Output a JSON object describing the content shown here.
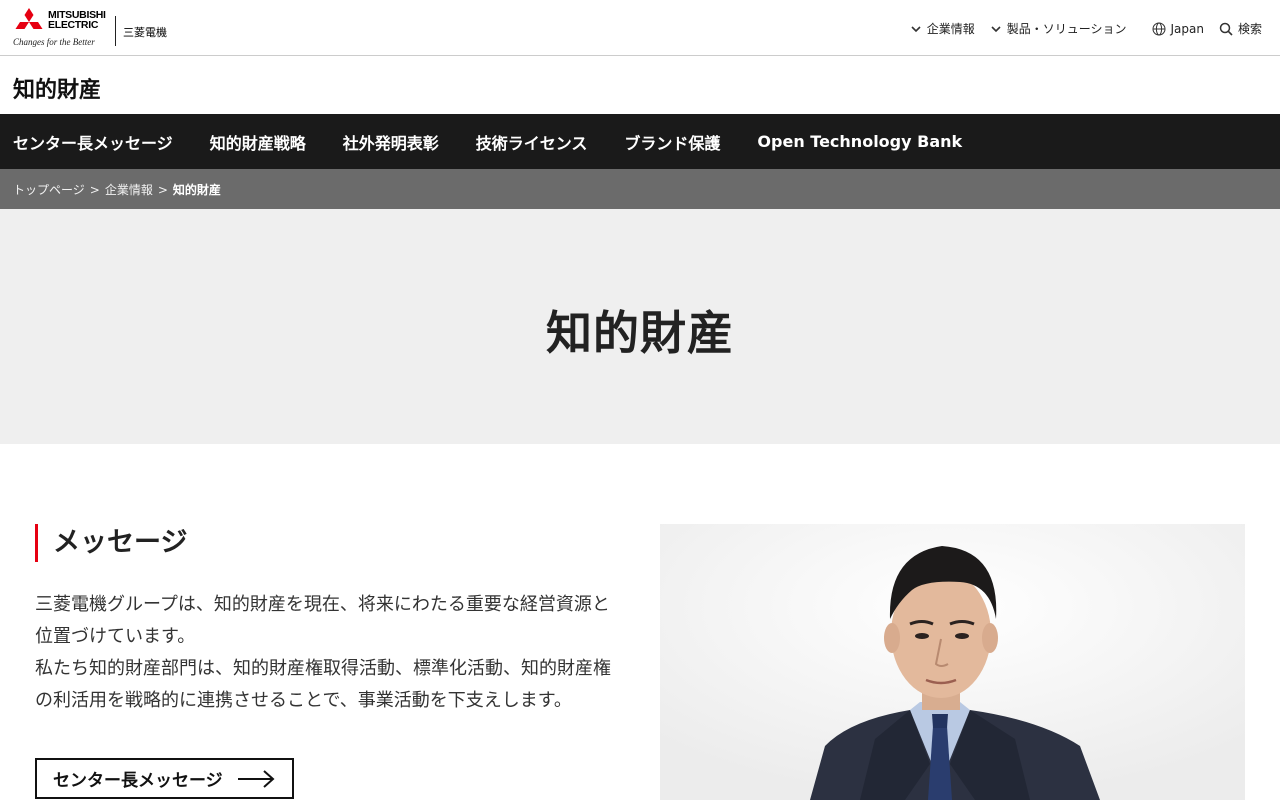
{
  "header": {
    "brand_en_line1": "MITSUBISHI",
    "brand_en_line2": "ELECTRIC",
    "tagline": "Changes for the Better",
    "brand_jp": "三菱電機",
    "util": {
      "corporate": "企業情報",
      "products": "製品・ソリューション",
      "region": "Japan",
      "search": "検索"
    }
  },
  "section_title": "知的財産",
  "nav": {
    "items": [
      {
        "label": "センター長メッセージ"
      },
      {
        "label": "知的財産戦略"
      },
      {
        "label": "社外発明表彰"
      },
      {
        "label": "技術ライセンス"
      },
      {
        "label": "ブランド保護"
      },
      {
        "label": "Open Technology Bank"
      }
    ]
  },
  "breadcrumb": {
    "items": [
      "トップページ",
      "企業情報",
      "知的財産"
    ],
    "separator": ">"
  },
  "hero": {
    "title": "知的財産"
  },
  "message": {
    "heading": "メッセージ",
    "lines": [
      "三菱電機グループは、知的財産を現在、将来にわたる重要な経営資源と",
      "位置づけています。",
      "私たち知的財産部門は、知的財産権取得活動、標準化活動、知的財産権",
      "の利活用を戦略的に連携させることで、事業活動を下支えします。"
    ],
    "button_label": "センター長メッセージ"
  },
  "colors": {
    "brand_red": "#e60012",
    "nav_bg": "#1a1a1a",
    "breadcrumb_bg": "#6b6b6b",
    "hero_bg": "#efefef"
  },
  "icons": {
    "chevron": "chevron-down-icon",
    "globe": "globe-icon",
    "search": "search-icon",
    "arrow": "arrow-right-icon"
  }
}
